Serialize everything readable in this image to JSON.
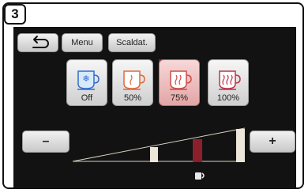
{
  "step": {
    "label": "3"
  },
  "toolbar": {
    "back_icon": "back-arrow-icon",
    "menu_label": "Menu",
    "scald_label": "Scaldat."
  },
  "temperatures": {
    "selected": "75%",
    "items": [
      {
        "icon": "snowflake-cup-icon",
        "label": "Off",
        "color": "#2f6fd0"
      },
      {
        "icon": "steam-cup-icon",
        "label": "50%",
        "color": "#e06a3a"
      },
      {
        "icon": "steam-cup-icon",
        "label": "75%",
        "color": "#d14a4a"
      },
      {
        "icon": "steam-cup-icon",
        "label": "100%",
        "color": "#c0334a"
      }
    ]
  },
  "adjust": {
    "minus_label": "–",
    "plus_label": "+",
    "level_icon": "pump-icon"
  },
  "colors": {
    "screen_bg": "#121212",
    "accent": "#8b1f2b"
  }
}
